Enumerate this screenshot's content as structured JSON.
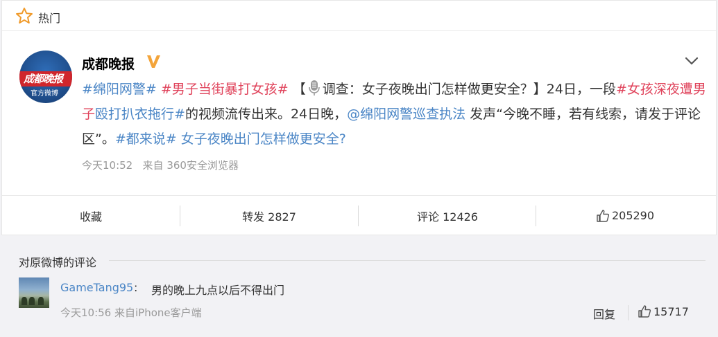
{
  "hot_bar": {
    "label": "热门"
  },
  "post": {
    "author": "成都晚报",
    "avatar_text_1": "成都晚报",
    "avatar_text_2": "官方微博",
    "segments": [
      {
        "text": "#绵阳网警#",
        "style": "tag"
      },
      {
        "text": " ",
        "style": "plain"
      },
      {
        "text": "#男子当街暴打女孩#",
        "style": "kw"
      },
      {
        "text": " 【",
        "style": "plain"
      },
      {
        "icon": "microphone-icon"
      },
      {
        "text": "调查：女子夜晚出门怎样做更安全？】24日，一段",
        "style": "plain"
      },
      {
        "text": "#女孩深夜遭",
        "style": "kw"
      },
      {
        "text": "男子",
        "style": "kw"
      },
      {
        "text": "殴打扒衣拖行#",
        "style": "tag"
      },
      {
        "text": "的视频流传出来。24日晚，",
        "style": "plain"
      },
      {
        "text": "@绵阳网警巡查执法",
        "style": "tag"
      },
      {
        "text": " 发声“今晚不睡，若有线索，请发于评论区”。",
        "style": "plain"
      },
      {
        "text": "#都来说#",
        "style": "tag"
      },
      {
        "text": " ",
        "style": "plain"
      },
      {
        "text": "女子夜晚出门怎样做更安全?",
        "style": "tag"
      }
    ],
    "time": "今天10:52",
    "source": "来自 360安全浏览器"
  },
  "actions": {
    "favorite": "收藏",
    "repost": "转发 2827",
    "comment": "评论 12426",
    "like_count": "205290"
  },
  "comments": {
    "header": "对原微博的评论",
    "items": [
      {
        "user": "GameTang95",
        "text": "男的晚上九点以后不得出门",
        "meta": "今天10:56 来自iPhone客户端",
        "reply_label": "回复",
        "likes": "15717"
      }
    ]
  },
  "colors": {
    "link_blue": "#4b86c6",
    "keyword_red": "#e0435b",
    "verified_orange": "#f3a43a",
    "background": "#f2f2f5"
  }
}
